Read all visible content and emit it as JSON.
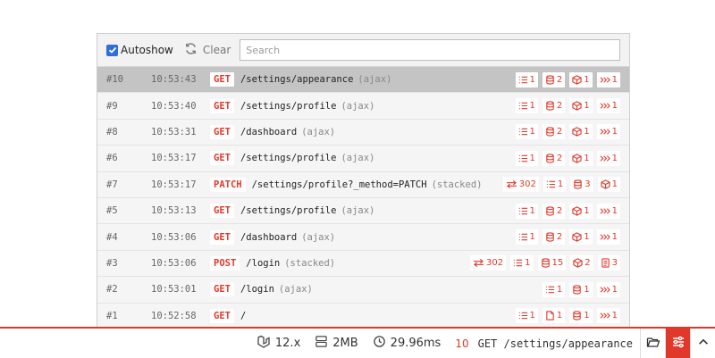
{
  "toolbar": {
    "autoshow_label": "Autoshow",
    "clear_label": "Clear",
    "search_placeholder": "Search"
  },
  "requests": [
    {
      "id": "#10",
      "time": "10:53:43",
      "method": "GET",
      "path": "/settings/appearance",
      "note": "(ajax)",
      "selected": true,
      "badges": [
        {
          "icon": "list",
          "n": "1"
        },
        {
          "icon": "db",
          "n": "2"
        },
        {
          "icon": "box",
          "n": "1"
        },
        {
          "icon": "event",
          "n": "1"
        }
      ]
    },
    {
      "id": "#9",
      "time": "10:53:40",
      "method": "GET",
      "path": "/settings/profile",
      "note": "(ajax)",
      "badges": [
        {
          "icon": "list",
          "n": "1"
        },
        {
          "icon": "db",
          "n": "2"
        },
        {
          "icon": "box",
          "n": "1"
        },
        {
          "icon": "event",
          "n": "1"
        }
      ]
    },
    {
      "id": "#8",
      "time": "10:53:31",
      "method": "GET",
      "path": "/dashboard",
      "note": "(ajax)",
      "badges": [
        {
          "icon": "list",
          "n": "1"
        },
        {
          "icon": "db",
          "n": "2"
        },
        {
          "icon": "box",
          "n": "1"
        },
        {
          "icon": "event",
          "n": "1"
        }
      ]
    },
    {
      "id": "#6",
      "time": "10:53:17",
      "method": "GET",
      "path": "/settings/profile",
      "note": "(ajax)",
      "badges": [
        {
          "icon": "list",
          "n": "1"
        },
        {
          "icon": "db",
          "n": "2"
        },
        {
          "icon": "box",
          "n": "1"
        },
        {
          "icon": "event",
          "n": "1"
        }
      ]
    },
    {
      "id": "#7",
      "time": "10:53:17",
      "method": "PATCH",
      "path": "/settings/profile?_method=PATCH",
      "note": "(stacked)",
      "badges": [
        {
          "icon": "redirect",
          "n": "302"
        },
        {
          "icon": "list",
          "n": "1"
        },
        {
          "icon": "db",
          "n": "3"
        },
        {
          "icon": "box",
          "n": "1"
        }
      ]
    },
    {
      "id": "#5",
      "time": "10:53:13",
      "method": "GET",
      "path": "/settings/profile",
      "note": "(ajax)",
      "badges": [
        {
          "icon": "list",
          "n": "1"
        },
        {
          "icon": "db",
          "n": "2"
        },
        {
          "icon": "box",
          "n": "1"
        },
        {
          "icon": "event",
          "n": "1"
        }
      ]
    },
    {
      "id": "#4",
      "time": "10:53:06",
      "method": "GET",
      "path": "/dashboard",
      "note": "(ajax)",
      "badges": [
        {
          "icon": "list",
          "n": "1"
        },
        {
          "icon": "db",
          "n": "2"
        },
        {
          "icon": "box",
          "n": "1"
        },
        {
          "icon": "event",
          "n": "1"
        }
      ]
    },
    {
      "id": "#3",
      "time": "10:53:06",
      "method": "POST",
      "path": "/login",
      "note": "(stacked)",
      "badges": [
        {
          "icon": "redirect",
          "n": "302"
        },
        {
          "icon": "list",
          "n": "1"
        },
        {
          "icon": "db",
          "n": "15"
        },
        {
          "icon": "box",
          "n": "2"
        },
        {
          "icon": "file",
          "n": "3"
        }
      ]
    },
    {
      "id": "#2",
      "time": "10:53:01",
      "method": "GET",
      "path": "/login",
      "note": "(ajax)",
      "badges": [
        {
          "icon": "list",
          "n": "1"
        },
        {
          "icon": "db",
          "n": "1"
        },
        {
          "icon": "event",
          "n": "1"
        }
      ]
    },
    {
      "id": "#1",
      "time": "10:52:58",
      "method": "GET",
      "path": "/",
      "note": "",
      "badges": [
        {
          "icon": "list",
          "n": "1"
        },
        {
          "icon": "doc",
          "n": "1"
        },
        {
          "icon": "db",
          "n": "1"
        },
        {
          "icon": "event",
          "n": "1"
        }
      ]
    }
  ],
  "footer": {
    "version": "12.x",
    "memory": "2MB",
    "duration": "29.96ms",
    "request_count": "10",
    "current_request": "GET /settings/appearance"
  },
  "colors": {
    "accent": "#e0392b",
    "selected_row": "#c4c4c4"
  }
}
